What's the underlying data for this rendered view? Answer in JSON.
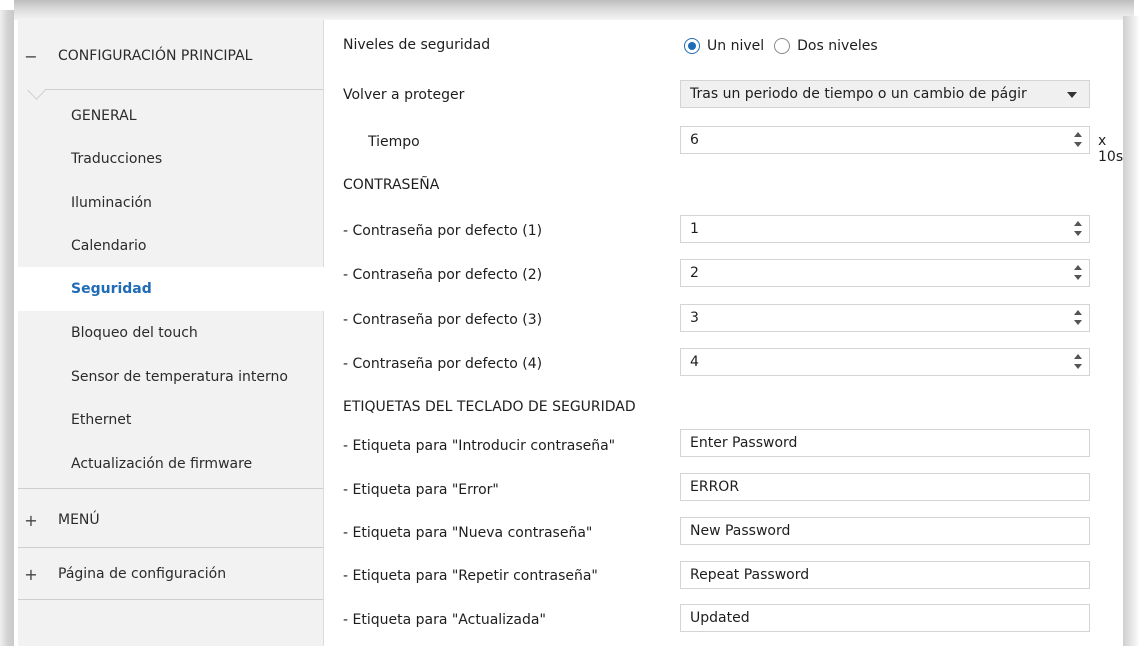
{
  "sidebar": {
    "group_main": {
      "toggle": "−",
      "label": "CONFIGURACIÓN PRINCIPAL"
    },
    "items": [
      {
        "label": "GENERAL"
      },
      {
        "label": "Traducciones"
      },
      {
        "label": "Iluminación"
      },
      {
        "label": "Calendario"
      },
      {
        "label": "Seguridad",
        "active": true
      },
      {
        "label": "Bloqueo del touch"
      },
      {
        "label": "Sensor de temperatura interno"
      },
      {
        "label": "Ethernet"
      },
      {
        "label": "Actualización de firmware"
      }
    ],
    "group_menu": {
      "toggle": "+",
      "label": "MENÚ"
    },
    "group_config_page": {
      "toggle": "+",
      "label": "Página de configuración"
    }
  },
  "main": {
    "security_levels": {
      "label": "Niveles de seguridad",
      "options": [
        "Un nivel",
        "Dos niveles"
      ],
      "selected": "Un nivel"
    },
    "reprotect": {
      "label": "Volver a proteger",
      "value": "Tras un periodo de tiempo o un cambio de págir"
    },
    "time": {
      "label": "Tiempo",
      "value": "6",
      "unit": "x 10s"
    },
    "password_section": "CONTRASEÑA",
    "passwords": [
      {
        "label": "- Contraseña por defecto (1)",
        "value": "1"
      },
      {
        "label": "- Contraseña por defecto (2)",
        "value": "2"
      },
      {
        "label": "- Contraseña por defecto (3)",
        "value": "3"
      },
      {
        "label": "- Contraseña por defecto (4)",
        "value": "4"
      }
    ],
    "keypad_section": "ETIQUETAS DEL TECLADO DE SEGURIDAD",
    "keypad_labels": [
      {
        "label": "- Etiqueta para \"Introducir contraseña\"",
        "value": "Enter Password"
      },
      {
        "label": "- Etiqueta para \"Error\"",
        "value": "ERROR"
      },
      {
        "label": "- Etiqueta para \"Nueva contraseña\"",
        "value": "New Password"
      },
      {
        "label": "- Etiqueta para \"Repetir contraseña\"",
        "value": "Repeat Password"
      },
      {
        "label": "- Etiqueta para \"Actualizada\"",
        "value": "Updated"
      }
    ]
  },
  "colors": {
    "accent": "#1f6bb5",
    "sidebar_bg": "#f2f2f2",
    "border": "#d4d4d4"
  }
}
